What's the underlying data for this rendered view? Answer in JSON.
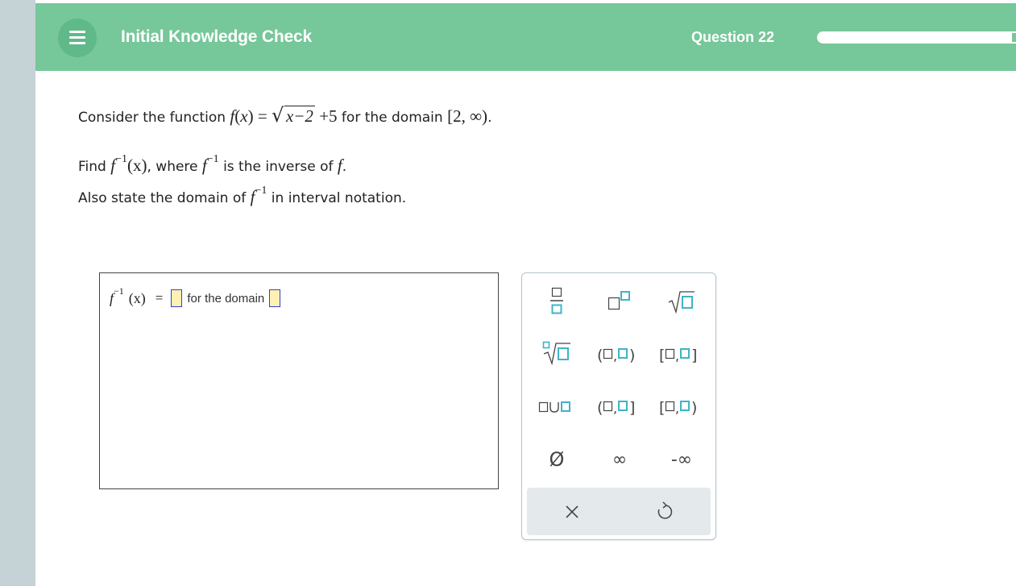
{
  "header": {
    "title": "Initial Knowledge Check",
    "question_label": "Question 22",
    "progress_fraction": 0.93
  },
  "question": {
    "line1": {
      "prefix": "Consider the function ",
      "f": "f",
      "open": "(",
      "x": "x",
      "close_eq": ") = ",
      "radicand": "x−2",
      "plus": " +5",
      "mid": " for the domain ",
      "domain": "[2, ∞)",
      "end": "."
    },
    "line2": {
      "prefix": "Find ",
      "f": "f",
      "exp": "−1",
      "arg": "(x)",
      "mid": ", where ",
      "f2": "f",
      "exp2": "−1",
      "suffix": " is the inverse of ",
      "f3": "f",
      "end": "."
    },
    "line3": {
      "prefix": "Also state the domain of ",
      "f": "f",
      "exp": "−1",
      "suffix": " in interval notation."
    }
  },
  "answer": {
    "f": "f",
    "exp": "−1",
    "arg": "(x)",
    "eq": "=",
    "domain_text": "for the domain"
  },
  "palette": {
    "buttons": [
      {
        "name": "fraction-button",
        "icon": "fraction-icon"
      },
      {
        "name": "exponent-button",
        "icon": "superscript-icon"
      },
      {
        "name": "square-root-button",
        "icon": "sqrt-icon"
      },
      {
        "name": "nth-root-button",
        "icon": "nth-root-icon"
      },
      {
        "name": "open-interval-button",
        "text": "(□,□)"
      },
      {
        "name": "closed-interval-button",
        "text": "[□,□]"
      },
      {
        "name": "union-button",
        "text": "□∪□"
      },
      {
        "name": "left-open-interval-button",
        "text": "(□,□]"
      },
      {
        "name": "right-open-interval-button",
        "text": "[□,□)"
      },
      {
        "name": "empty-set-button",
        "text": "Ø"
      },
      {
        "name": "infinity-button",
        "text": "∞"
      },
      {
        "name": "negative-infinity-button",
        "text": "-∞"
      }
    ],
    "footer": {
      "clear_icon": "close-icon",
      "undo_icon": "undo-icon",
      "clear": "×",
      "undo": "↺"
    }
  },
  "colors": {
    "header_green": "#76c799",
    "menu_circle": "#5fb988",
    "rail": "#c5d2d6",
    "teal": "#3eb4c6",
    "slot_fill": "#fff1b3",
    "slot_border": "#3a3ad6"
  }
}
